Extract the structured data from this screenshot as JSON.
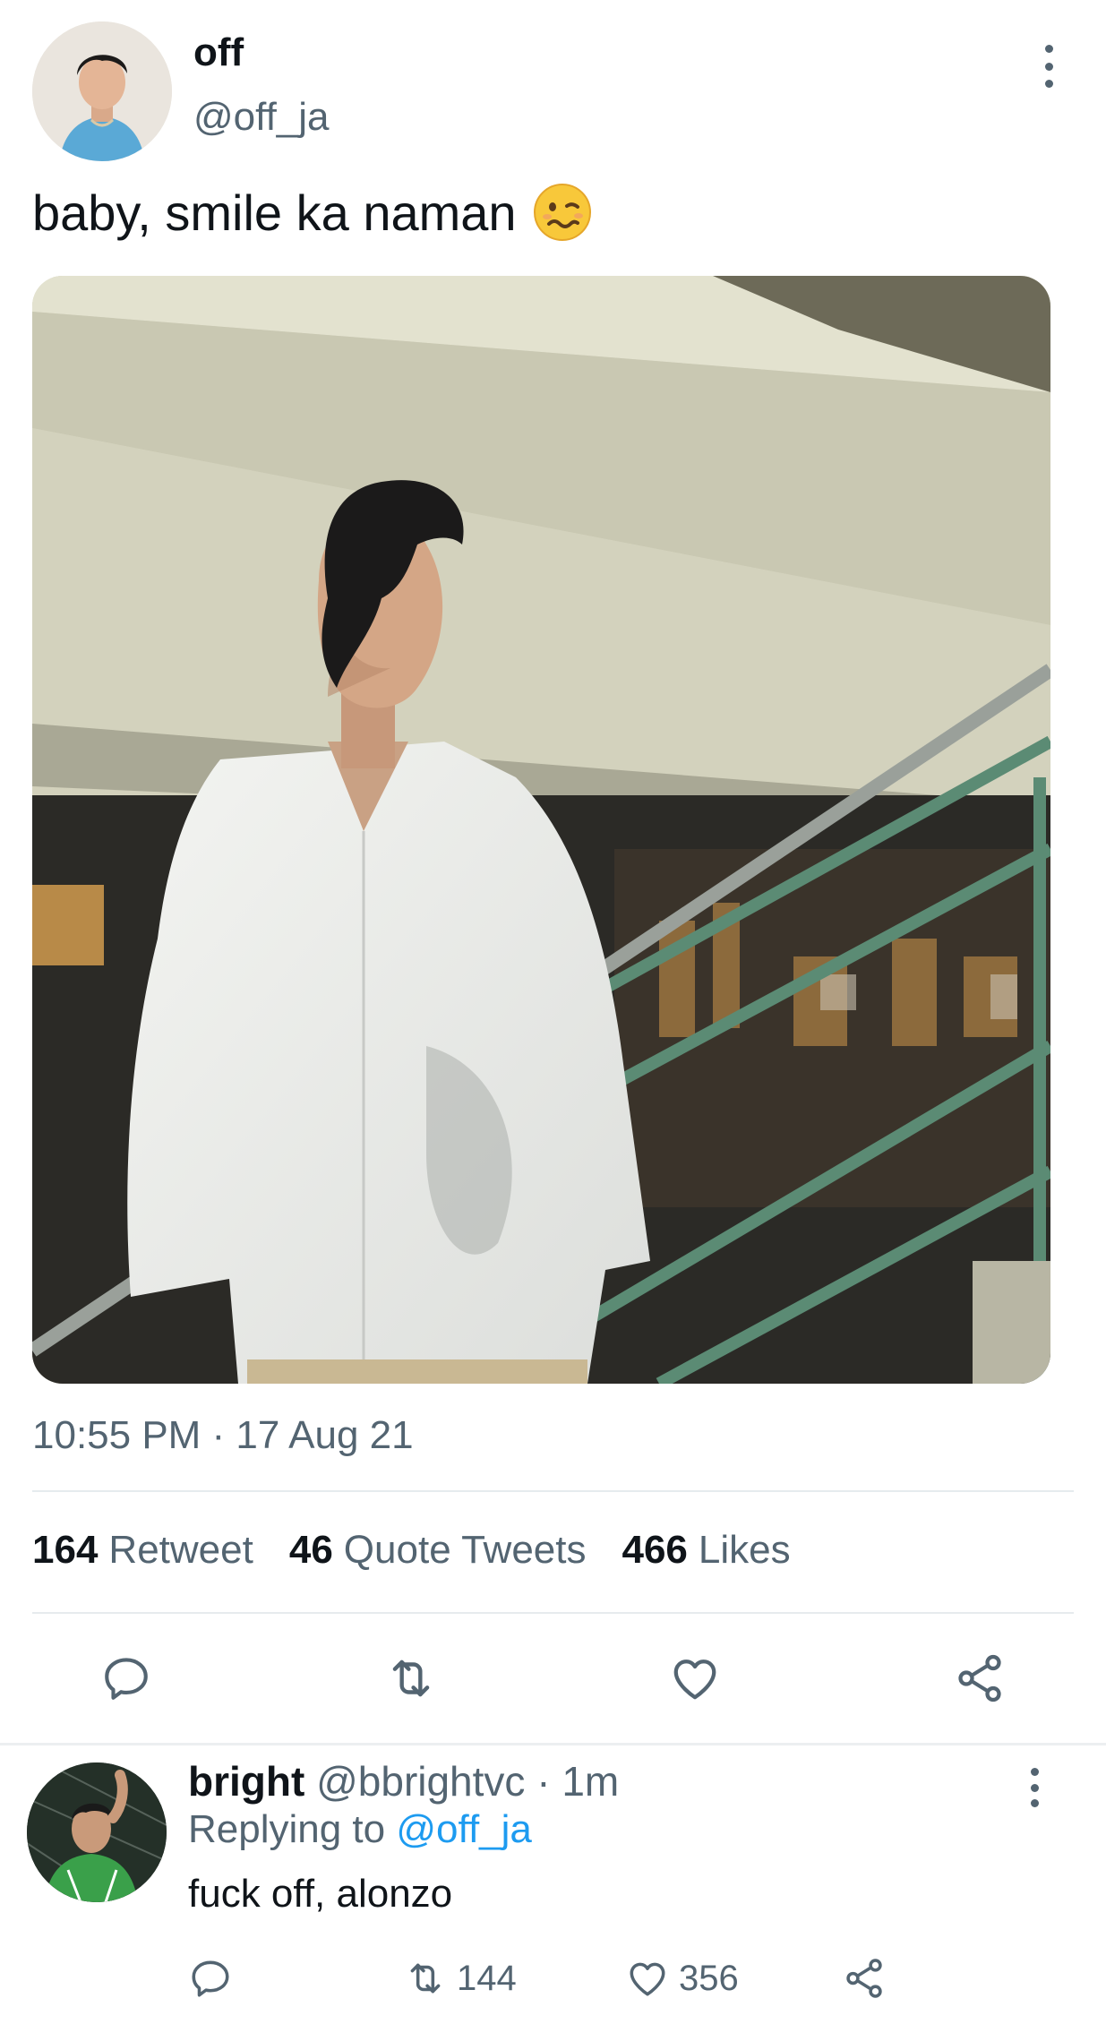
{
  "tweet": {
    "display_name": "off",
    "handle": "@off_ja",
    "text": "baby, smile ka naman",
    "emoji": "woozy-face",
    "timestamp": "10:55 PM · 17 Aug 21",
    "stats": {
      "retweets_count": "164",
      "retweets_label": "Retweet",
      "quotes_count": "46",
      "quotes_label": "Quote Tweets",
      "likes_count": "466",
      "likes_label": "Likes"
    },
    "actions": [
      "reply-icon",
      "retweet-icon",
      "like-icon",
      "share-icon"
    ]
  },
  "reply": {
    "display_name": "bright",
    "handle": "@bbrightvc",
    "time": "· 1m",
    "replying_prefix": "Replying to",
    "replying_to": "@off_ja",
    "text": "fuck off, alonzo",
    "retweets": "144",
    "likes": "356"
  },
  "colors": {
    "text": "#0f1419",
    "secondary": "#536471",
    "accent": "#1d9bf0",
    "divider": "#e6ebee"
  }
}
